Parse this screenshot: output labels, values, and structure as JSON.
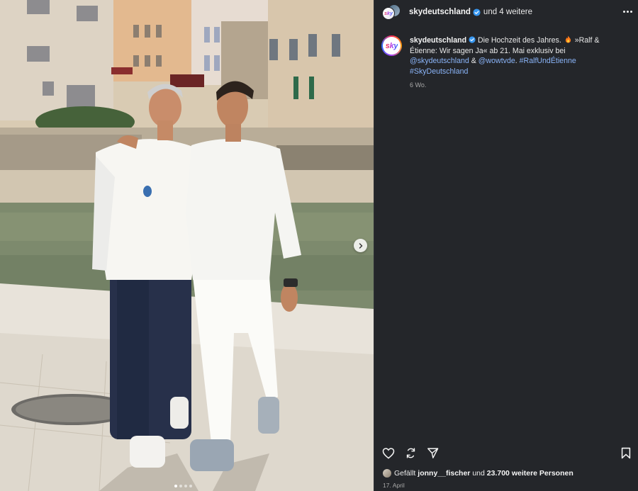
{
  "post": {
    "header": {
      "username": "skydeutschland",
      "collab_text": "und 4 weitere",
      "avatar_icon": "sky-logo-icon"
    },
    "caption": {
      "username": "skydeutschland",
      "text_1": "Die Hochzeit des Jahres.",
      "text_2": "»Ralf & Étienne: Wir sagen Ja« ab 21. Mai exklusiv bei",
      "mention_1": "@skydeutschland",
      "amp": "&",
      "mention_2": "@wowtvde",
      "period": ".",
      "hashtag_1": "#RalfUndÉtienne",
      "hashtag_2": "#SkyDeutschland",
      "time_ago": "6 Wo."
    },
    "likes": {
      "prefix": "Gefällt",
      "user": "jonny__fischer",
      "mid": "und",
      "count": "23.700 weitere Personen"
    },
    "date": "17. April",
    "carousel": {
      "slides": 4,
      "active_index": 0
    },
    "logo_text": "sky"
  },
  "colors": {
    "panel_bg": "#24262a",
    "link": "#8ab4f8",
    "verified": "#3897f0"
  }
}
